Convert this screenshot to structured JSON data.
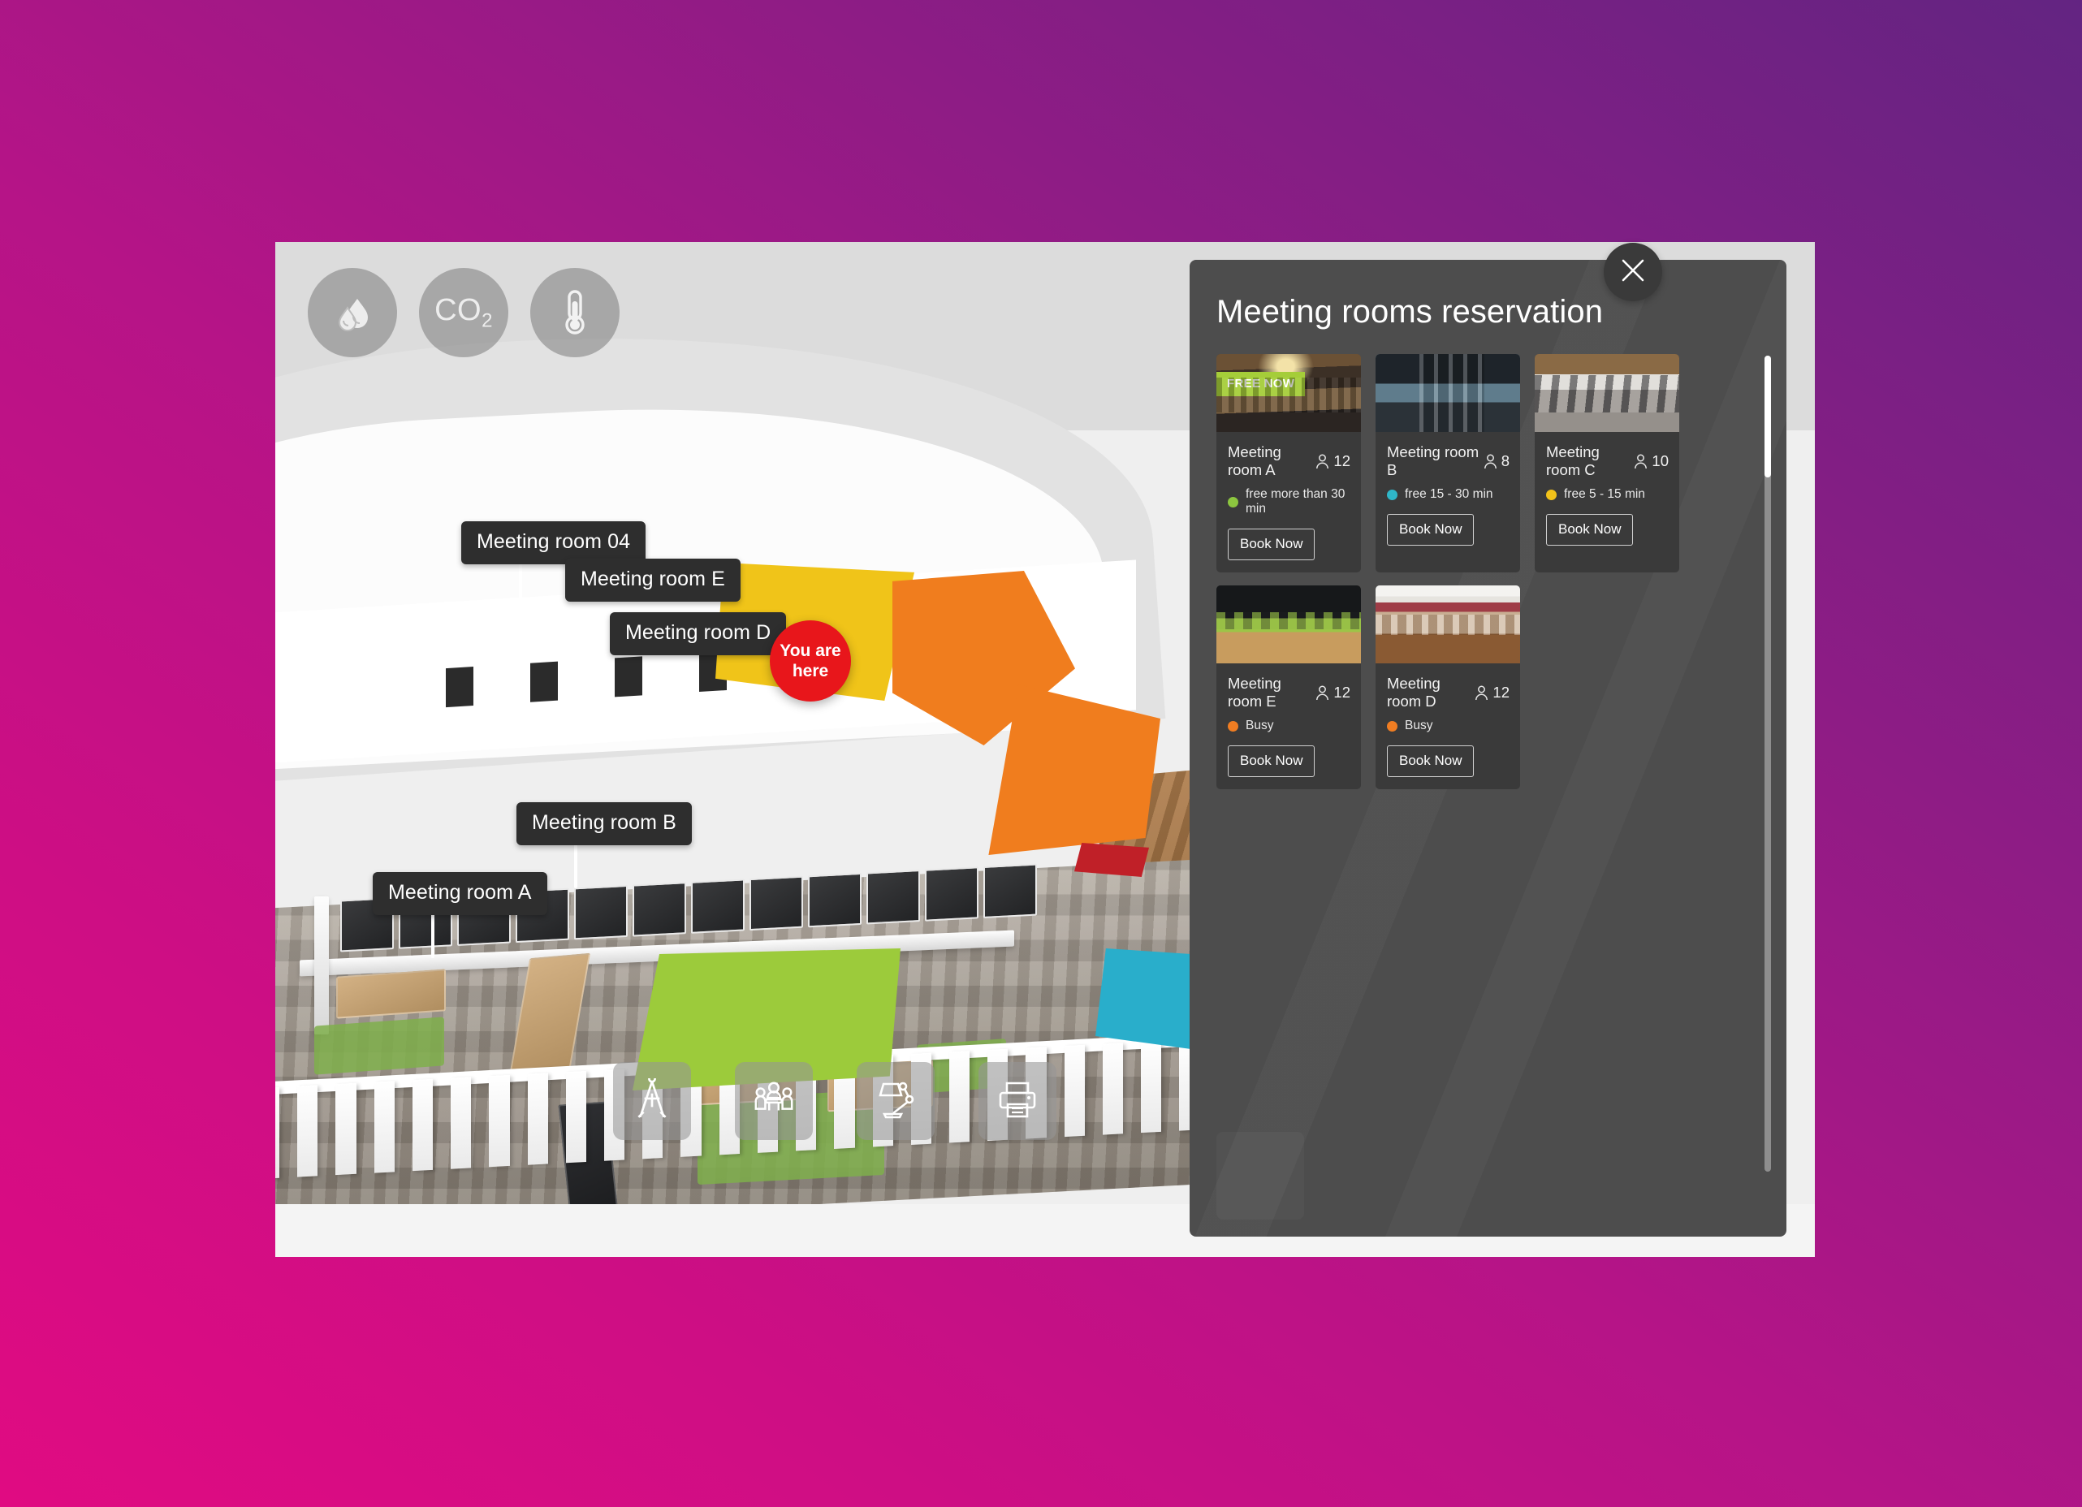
{
  "background": {
    "gradient_from": "#E00B82",
    "gradient_to": "#632482"
  },
  "app": {
    "sensor_bar": [
      {
        "name": "humidity-icon",
        "label": "Humidity"
      },
      {
        "name": "co2-icon",
        "label": "CO",
        "sub": "2"
      },
      {
        "name": "temperature-icon",
        "label": "Temperature"
      }
    ],
    "utility_bar": [
      {
        "name": "compass-icon",
        "label": "Design"
      },
      {
        "name": "meeting-people-icon",
        "label": "Meeting"
      },
      {
        "name": "desk-lamp-icon",
        "label": "Workplace"
      },
      {
        "name": "printer-icon",
        "label": "Print"
      }
    ],
    "map": {
      "you_are_here": "You are here",
      "labels": [
        {
          "id": "04",
          "text": "Meeting room 04",
          "color": "#F0C419"
        },
        {
          "id": "E",
          "text": "Meeting room E",
          "color": "#F07D1E"
        },
        {
          "id": "D",
          "text": "Meeting room D",
          "color": "#F07D1E"
        },
        {
          "id": "B",
          "text": "Meeting room B",
          "color": "#29AECB"
        },
        {
          "id": "A",
          "text": "Meeting room A",
          "color": "#9CCB3B"
        }
      ]
    }
  },
  "panel": {
    "title": "Meeting rooms reservation",
    "close_label": "×",
    "capacity_icon": "person-icon",
    "book_label": "Book Now",
    "free_badge": "FREE NOW",
    "status_colors": {
      "free_30": "#8CC63F",
      "free_15_30": "#2FB6C8",
      "free_5_15": "#F2C21A",
      "busy": "#F07D22"
    },
    "rooms": [
      {
        "name": "Meeting room A",
        "capacity": "12",
        "status": "free more than 30 min",
        "status_color": "#8CC63F",
        "badge": "FREE NOW",
        "book": "Book Now",
        "photo_class": "ph-a"
      },
      {
        "name": "Meeting room B",
        "capacity": "8",
        "status": "free 15 - 30 min",
        "status_color": "#2FB6C8",
        "badge": "",
        "book": "Book Now",
        "photo_class": "ph-b"
      },
      {
        "name": "Meeting room C",
        "capacity": "10",
        "status": "free 5 - 15 min",
        "status_color": "#F2C21A",
        "badge": "",
        "book": "Book Now",
        "photo_class": "ph-c"
      },
      {
        "name": "Meeting room E",
        "capacity": "12",
        "status": "Busy",
        "status_color": "#F07D22",
        "badge": "",
        "book": "Book Now",
        "photo_class": "ph-e"
      },
      {
        "name": "Meeting room D",
        "capacity": "12",
        "status": "Busy",
        "status_color": "#F07D22",
        "badge": "",
        "book": "Book Now",
        "photo_class": "ph-d"
      }
    ]
  }
}
